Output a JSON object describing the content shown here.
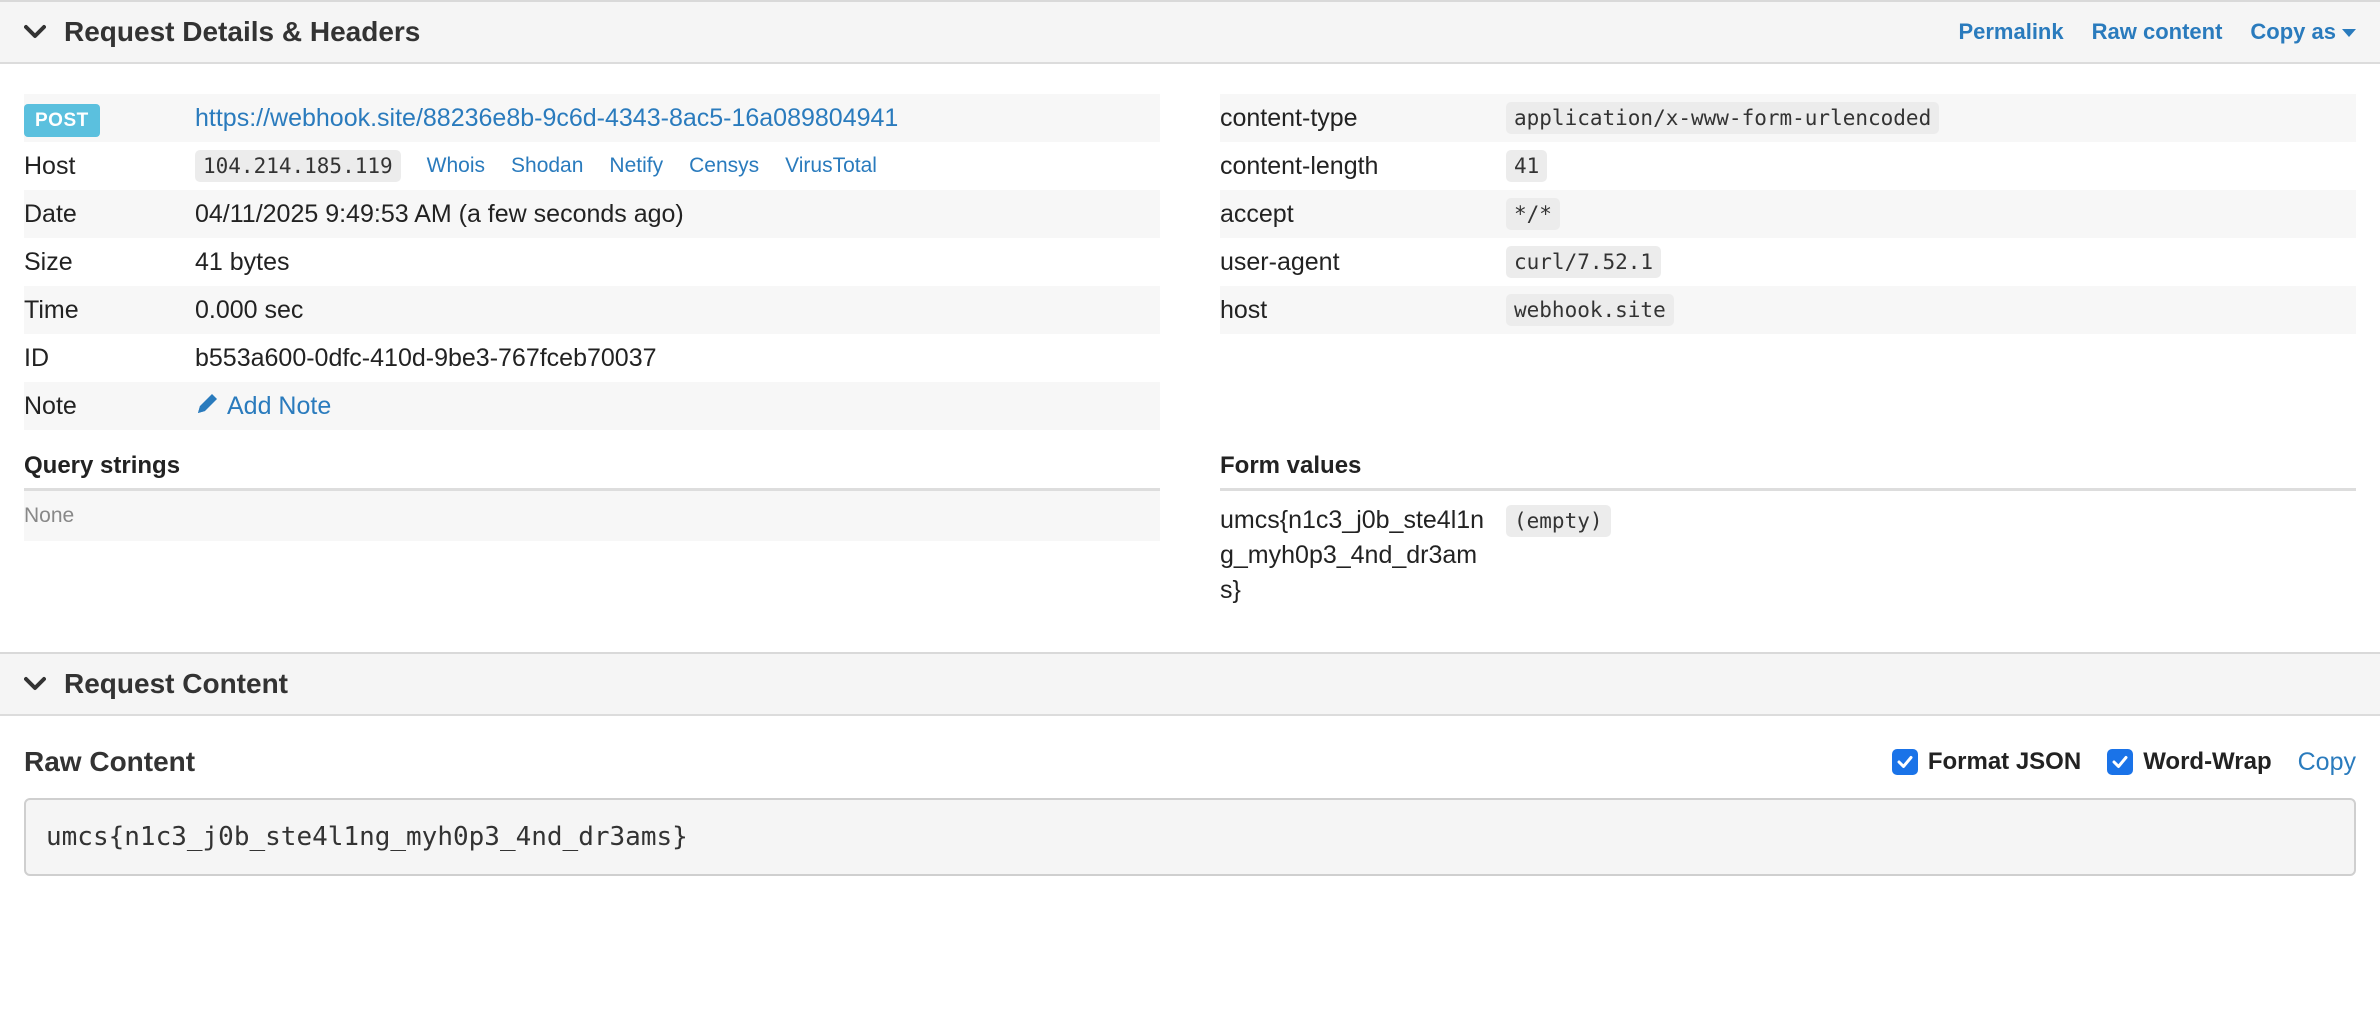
{
  "details_panel": {
    "title": "Request Details & Headers",
    "actions": {
      "permalink": "Permalink",
      "raw_content": "Raw content",
      "copy_as": "Copy as"
    }
  },
  "request": {
    "method": "POST",
    "url": "https://webhook.site/88236e8b-9c6d-4343-8ac5-16a089804941",
    "host_label": "Host",
    "host": "104.214.185.119",
    "host_links": [
      "Whois",
      "Shodan",
      "Netify",
      "Censys",
      "VirusTotal"
    ],
    "date_label": "Date",
    "date": "04/11/2025 9:49:53 AM (a few seconds ago)",
    "size_label": "Size",
    "size": "41 bytes",
    "time_label": "Time",
    "time": "0.000 sec",
    "id_label": "ID",
    "id": "b553a600-0dfc-410d-9be3-767fceb70037",
    "note_label": "Note",
    "add_note": "Add Note"
  },
  "headers": [
    {
      "key": "content-type",
      "value": "application/x-www-form-urlencoded"
    },
    {
      "key": "content-length",
      "value": "41"
    },
    {
      "key": "accept",
      "value": "*/*"
    },
    {
      "key": "user-agent",
      "value": "curl/7.52.1"
    },
    {
      "key": "host",
      "value": "webhook.site"
    }
  ],
  "query_strings": {
    "title": "Query strings",
    "empty": "None"
  },
  "form_values": {
    "title": "Form values",
    "rows": [
      {
        "key": "umcs{n1c3_j0b_ste4l1ng_myh0p3_4nd_dr3ams}",
        "value": "(empty)"
      }
    ]
  },
  "content_panel": {
    "title": "Request Content"
  },
  "raw_content": {
    "title": "Raw Content",
    "format_json_label": "Format JSON",
    "format_json_checked": true,
    "word_wrap_label": "Word-Wrap",
    "word_wrap_checked": true,
    "copy_label": "Copy",
    "body": "umcs{n1c3_j0b_ste4l1ng_myh0p3_4nd_dr3ams}"
  },
  "colors": {
    "link": "#2a7bbd",
    "badge": "#5bc0de",
    "checkbox": "#1a73e8"
  }
}
